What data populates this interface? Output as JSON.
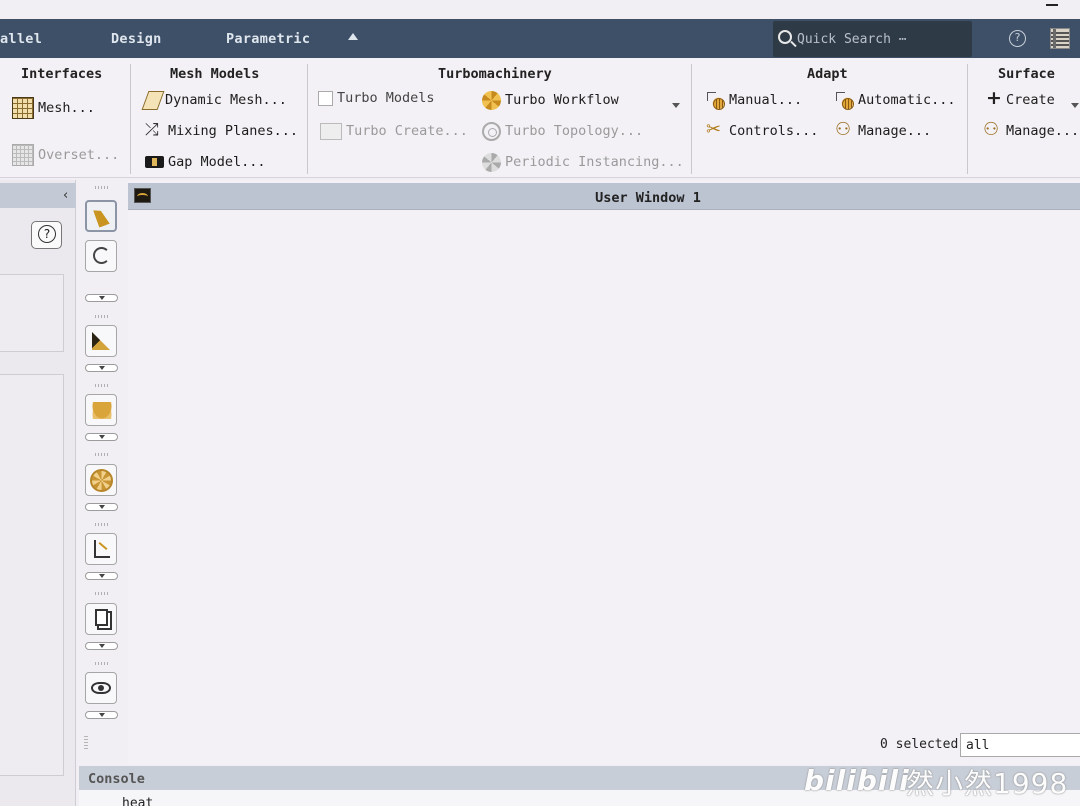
{
  "menubar": {
    "items": [
      "allel",
      "Design",
      "Parametric"
    ],
    "search_placeholder": "Quick Search ⋯",
    "help_glyph": "?"
  },
  "ribbon": {
    "interfaces": {
      "title": "Interfaces",
      "mesh": "Mesh...",
      "overset": "Overset..."
    },
    "mesh_models": {
      "title": "Mesh Models",
      "dynamic_mesh": "Dynamic Mesh...",
      "mixing_planes": "Mixing Planes...",
      "gap_model": "Gap Model..."
    },
    "turbomachinery": {
      "title": "Turbomachinery",
      "turbo_models": "Turbo Models",
      "turbo_workflow": "Turbo Workflow",
      "turbo_create": "Turbo Create...",
      "turbo_topology": "Turbo Topology...",
      "periodic_instancing": "Periodic Instancing..."
    },
    "adapt": {
      "title": "Adapt",
      "manual": "Manual...",
      "automatic": "Automatic...",
      "controls": "Controls...",
      "manage": "Manage..."
    },
    "surface": {
      "title": "Surface",
      "create": "Create",
      "manage": "Manage..."
    }
  },
  "leftpanel": {
    "collapse_glyph": "‹",
    "help_glyph": "?"
  },
  "graphics": {
    "window_title": "User Window 1",
    "selected_count": "0 selected",
    "filter_value": "all"
  },
  "console": {
    "title": "Console",
    "text": "heat"
  },
  "watermark": {
    "logo": "bilibili",
    "text": "然小然1998"
  }
}
